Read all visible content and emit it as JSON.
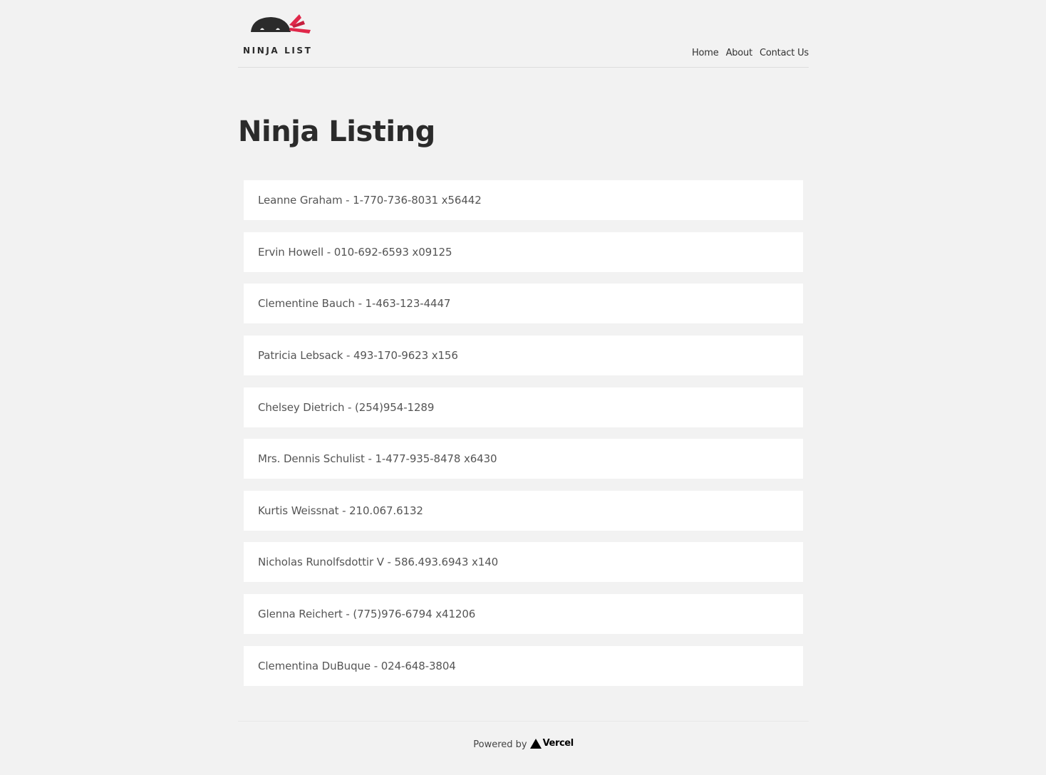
{
  "brand": {
    "logo_text": "NINJA LIST",
    "colors": {
      "dark": "#2b2b2b",
      "accent": "#e0284a"
    }
  },
  "nav": {
    "links": [
      "Home",
      "About",
      "Contact Us"
    ]
  },
  "main": {
    "title": "Ninja Listing",
    "ninjas": [
      "Leanne Graham - 1-770-736-8031 x56442",
      "Ervin Howell - 010-692-6593 x09125",
      "Clementine Bauch - 1-463-123-4447",
      "Patricia Lebsack - 493-170-9623 x156",
      "Chelsey Dietrich - (254)954-1289",
      "Mrs. Dennis Schulist - 1-477-935-8478 x6430",
      "Kurtis Weissnat - 210.067.6132",
      "Nicholas Runolfsdottir V - 586.493.6943 x140",
      "Glenna Reichert - (775)976-6794 x41206",
      "Clementina DuBuque - 024-648-3804"
    ]
  },
  "footer": {
    "powered_by": "Powered by",
    "vercel_label": "Vercel",
    "vercel_icon": "triangle-icon"
  }
}
